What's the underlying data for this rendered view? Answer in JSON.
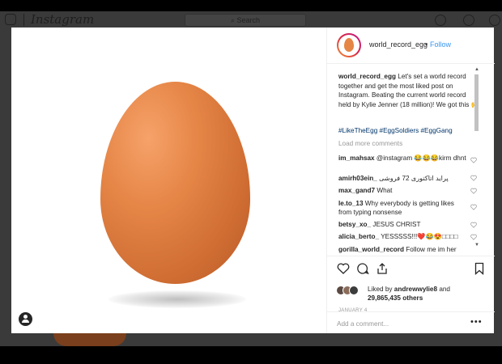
{
  "app": {
    "name": "Instagram",
    "search_placeholder": "Search"
  },
  "post": {
    "username": "world_record_egg",
    "separator": "•",
    "follow_label": "Follow",
    "caption": {
      "username": "world_record_egg",
      "text": "Let's set a world record together and get the most liked post on Instagram. Beating the current world record held by Kylie Jenner (18 million)! We got this 🙌",
      "hashtags": "#LikeTheEgg #EggSoldiers #EggGang"
    },
    "load_more_label": "Load more comments",
    "comments": [
      {
        "username": "im_mahsax",
        "text": "@instagram 😂😂😂kirm dhnt"
      },
      {
        "username": "amirh03ein_",
        "text": "پراید اتاکتوری 72 فروشی"
      },
      {
        "username": "max_gand7",
        "text": "What"
      },
      {
        "username": "le.to_13",
        "text": "Why everybody is getting likes from typing nonsense"
      },
      {
        "username": "betsy_xo_",
        "text": "JESUS CHRIST"
      },
      {
        "username": "alicia_berto_",
        "text": "YESSSSS!!!❤️😂😍□□□□"
      },
      {
        "username": "gorilla_world_record",
        "text": "Follow me im her"
      }
    ],
    "likes": {
      "prefix": "Liked by",
      "user": "andrewwylie8",
      "joiner": "and",
      "count": "29,865,435 others"
    },
    "date": "JANUARY 4",
    "add_comment_placeholder": "Add a comment...",
    "more_label": "•••"
  },
  "colors": {
    "accent": "#3897f0",
    "egg": "#e58546",
    "text": "#262626",
    "muted": "#999999"
  }
}
